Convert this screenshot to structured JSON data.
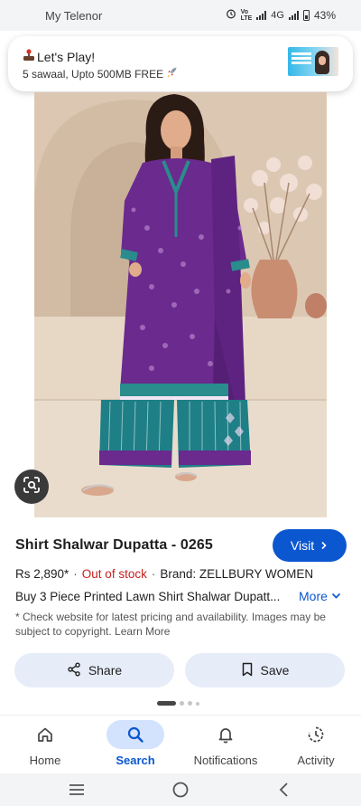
{
  "status_bar": {
    "carrier": "My Telenor",
    "network": "4G",
    "battery": "43%"
  },
  "notification": {
    "title": "Let's Play!",
    "subtitle": "5 sawaal, Upto 500MB FREE",
    "title_icon": "joystick-emoji",
    "subtitle_icon": "rocket-emoji"
  },
  "product": {
    "title": "Shirt Shalwar Dupatta - 0265",
    "price": "Rs 2,890*",
    "stock_status": "Out of stock",
    "brand": "Brand: ZELLBURY WOMEN",
    "description": "Buy 3 Piece Printed Lawn Shirt Shalwar Dupatt...",
    "more_label": "More",
    "disclaimer": "* Check website for latest pricing and availability. Images may be subject to copyright. Learn More",
    "visit_label": "Visit",
    "colors": {
      "accent": "#0b57d0",
      "out_of_stock": "#c5221f",
      "dress": "#6a2a8e",
      "trim": "#2a8c8c"
    }
  },
  "actions": {
    "share_label": "Share",
    "save_label": "Save"
  },
  "bottom_nav": {
    "items": [
      {
        "label": "Home",
        "icon": "home-icon",
        "active": false
      },
      {
        "label": "Search",
        "icon": "search-icon",
        "active": true
      },
      {
        "label": "Notifications",
        "icon": "bell-icon",
        "active": false
      },
      {
        "label": "Activity",
        "icon": "activity-icon",
        "active": false
      }
    ]
  },
  "system_nav": {
    "icons": [
      "recents-icon",
      "home-circle-icon",
      "back-icon"
    ]
  }
}
